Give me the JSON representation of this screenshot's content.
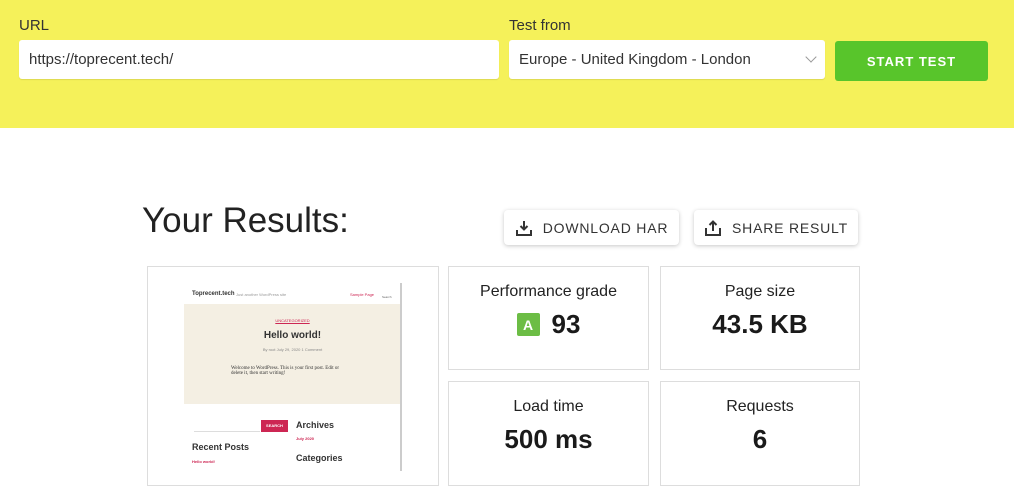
{
  "form": {
    "url_label": "URL",
    "url_value": "https://toprecent.tech/",
    "test_from_label": "Test from",
    "test_from_value": "Europe - United Kingdom - London",
    "start_label": "START TEST"
  },
  "results": {
    "title": "Your Results:",
    "download_label": "DOWNLOAD HAR",
    "share_label": "SHARE RESULT"
  },
  "metrics": {
    "performance": {
      "label": "Performance grade",
      "grade": "A",
      "value": "93"
    },
    "page_size": {
      "label": "Page size",
      "value": "43.5 KB"
    },
    "load_time": {
      "label": "Load time",
      "value": "500 ms"
    },
    "requests": {
      "label": "Requests",
      "value": "6"
    }
  },
  "thumbnail": {
    "site": "Toprecent.tech",
    "tagline": "Just another WordPress site",
    "nav": "Sample Page",
    "search": "Search",
    "category": "UNCATEGORIZED",
    "post_title": "Hello world!",
    "meta": "By root   July 29, 2020   1 Comment",
    "excerpt": "Welcome to WordPress. This is your first post. Edit or delete it, then start writing!",
    "search_btn": "SEARCH",
    "archives": "Archives",
    "archive_item": "July 2020",
    "recent": "Recent Posts",
    "recent_item": "Hello world!",
    "categories": "Categories"
  },
  "colors": {
    "header_bg": "#f5f15a",
    "start_button": "#58c52b",
    "grade_a": "#6cbd45"
  }
}
